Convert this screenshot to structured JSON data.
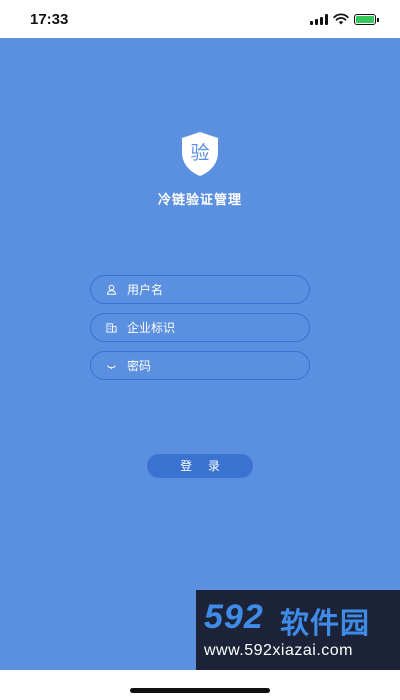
{
  "status_bar": {
    "time": "17:33",
    "icons": [
      "signal-icon",
      "wifi-icon",
      "battery-charging-icon"
    ]
  },
  "app": {
    "logo_text": "验",
    "title": "冷链验证管理"
  },
  "form": {
    "username": {
      "placeholder": "用户名",
      "value": "",
      "icon": "user-icon"
    },
    "enterprise_id": {
      "placeholder": "企业标识",
      "value": "",
      "icon": "building-icon"
    },
    "password": {
      "placeholder": "密码",
      "value": "",
      "icon": "key-icon"
    }
  },
  "login_button": {
    "label": "登 录"
  },
  "watermark": {
    "brand_num": "592",
    "brand_cn": "软件园",
    "url": "www.592xiazai.com"
  },
  "colors": {
    "background": "#5b8fdf",
    "accent": "#3a72d2",
    "text": "#ffffff",
    "battery": "#34c759"
  }
}
